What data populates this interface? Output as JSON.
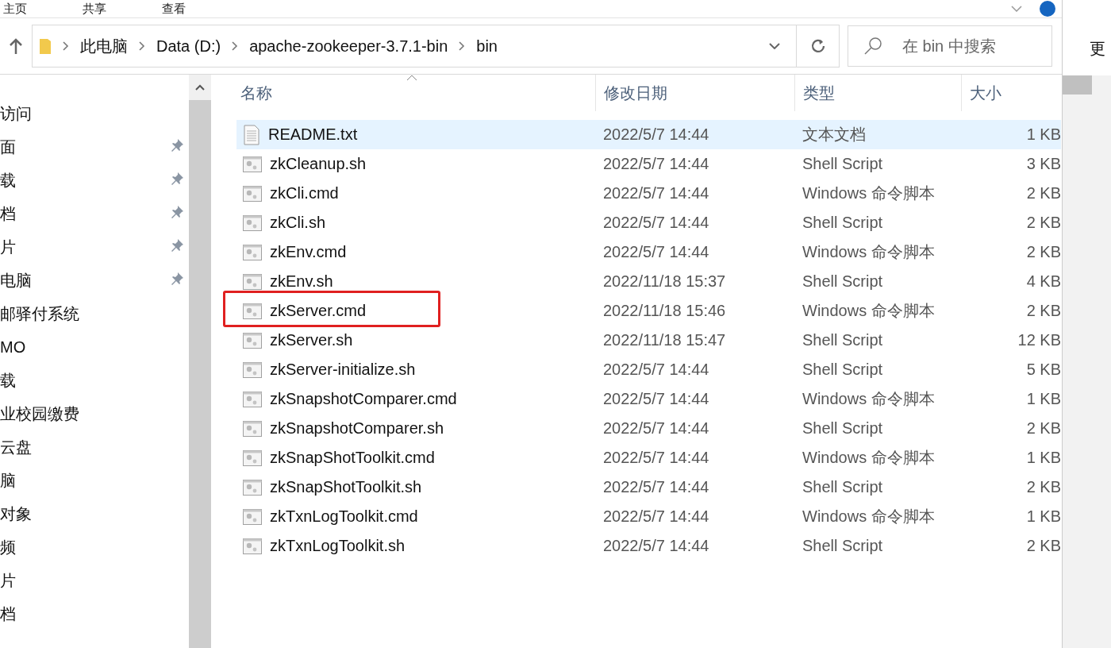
{
  "ribbon_tabs": [
    {
      "label": "主页",
      "selected": false
    },
    {
      "label": "共享",
      "selected": false
    },
    {
      "label": "查看",
      "selected": false
    }
  ],
  "address_bar": {
    "crumbs": [
      "此电脑",
      "Data (D:)",
      "apache-zookeeper-3.7.1-bin",
      "bin"
    ]
  },
  "search": {
    "placeholder": "在 bin 中搜索"
  },
  "sidebar": {
    "items": [
      {
        "label": "访问",
        "pinned": false
      },
      {
        "label": "面",
        "pinned": true
      },
      {
        "label": "载",
        "pinned": true
      },
      {
        "label": "档",
        "pinned": true
      },
      {
        "label": "片",
        "pinned": true
      },
      {
        "label": "电脑",
        "pinned": true
      },
      {
        "label": "邮驿付系统",
        "pinned": false
      },
      {
        "label": "MO",
        "pinned": false
      },
      {
        "label": "载",
        "pinned": false
      },
      {
        "label": "业校园缴费",
        "pinned": false
      },
      {
        "label": "云盘",
        "pinned": false
      },
      {
        "label": "脑",
        "pinned": false
      },
      {
        "label": "对象",
        "pinned": false
      },
      {
        "label": "频",
        "pinned": false
      },
      {
        "label": "片",
        "pinned": false
      },
      {
        "label": "档",
        "pinned": false
      }
    ]
  },
  "table": {
    "columns": [
      "名称",
      "修改日期",
      "类型",
      "大小"
    ],
    "rows": [
      {
        "kind": "text",
        "name": "README.txt",
        "date": "2022/5/7 14:44",
        "type": "文本文档",
        "size": "1 KB",
        "selected": true,
        "highlighted": false
      },
      {
        "kind": "script",
        "name": "zkCleanup.sh",
        "date": "2022/5/7 14:44",
        "type": "Shell Script",
        "size": "3 KB",
        "selected": false,
        "highlighted": false
      },
      {
        "kind": "script",
        "name": "zkCli.cmd",
        "date": "2022/5/7 14:44",
        "type": "Windows 命令脚本",
        "size": "2 KB",
        "selected": false,
        "highlighted": false
      },
      {
        "kind": "script",
        "name": "zkCli.sh",
        "date": "2022/5/7 14:44",
        "type": "Shell Script",
        "size": "2 KB",
        "selected": false,
        "highlighted": false
      },
      {
        "kind": "script",
        "name": "zkEnv.cmd",
        "date": "2022/5/7 14:44",
        "type": "Windows 命令脚本",
        "size": "2 KB",
        "selected": false,
        "highlighted": false
      },
      {
        "kind": "script",
        "name": "zkEnv.sh",
        "date": "2022/11/18 15:37",
        "type": "Shell Script",
        "size": "4 KB",
        "selected": false,
        "highlighted": false
      },
      {
        "kind": "script",
        "name": "zkServer.cmd",
        "date": "2022/11/18 15:46",
        "type": "Windows 命令脚本",
        "size": "2 KB",
        "selected": false,
        "highlighted": true
      },
      {
        "kind": "script",
        "name": "zkServer.sh",
        "date": "2022/11/18 15:47",
        "type": "Shell Script",
        "size": "12 KB",
        "selected": false,
        "highlighted": false
      },
      {
        "kind": "script",
        "name": "zkServer-initialize.sh",
        "date": "2022/5/7 14:44",
        "type": "Shell Script",
        "size": "5 KB",
        "selected": false,
        "highlighted": false
      },
      {
        "kind": "script",
        "name": "zkSnapshotComparer.cmd",
        "date": "2022/5/7 14:44",
        "type": "Windows 命令脚本",
        "size": "1 KB",
        "selected": false,
        "highlighted": false
      },
      {
        "kind": "script",
        "name": "zkSnapshotComparer.sh",
        "date": "2022/5/7 14:44",
        "type": "Shell Script",
        "size": "2 KB",
        "selected": false,
        "highlighted": false
      },
      {
        "kind": "script",
        "name": "zkSnapShotToolkit.cmd",
        "date": "2022/5/7 14:44",
        "type": "Windows 命令脚本",
        "size": "1 KB",
        "selected": false,
        "highlighted": false
      },
      {
        "kind": "script",
        "name": "zkSnapShotToolkit.sh",
        "date": "2022/5/7 14:44",
        "type": "Shell Script",
        "size": "2 KB",
        "selected": false,
        "highlighted": false
      },
      {
        "kind": "script",
        "name": "zkTxnLogToolkit.cmd",
        "date": "2022/5/7 14:44",
        "type": "Windows 命令脚本",
        "size": "1 KB",
        "selected": false,
        "highlighted": false
      },
      {
        "kind": "script",
        "name": "zkTxnLogToolkit.sh",
        "date": "2022/5/7 14:44",
        "type": "Shell Script",
        "size": "2 KB",
        "selected": false,
        "highlighted": false
      }
    ]
  },
  "side_window": {
    "text": "更"
  }
}
